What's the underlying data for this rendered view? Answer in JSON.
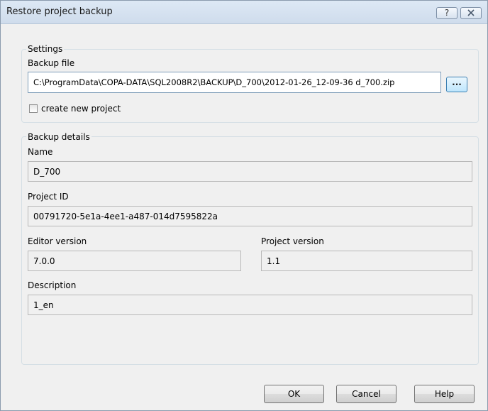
{
  "window": {
    "title": "Restore project backup",
    "help_glyph": "?",
    "close_icon": "close-icon"
  },
  "settings": {
    "group_label": "Settings",
    "backup_file_label": "Backup file",
    "backup_file_value": "C:\\ProgramData\\COPA-DATA\\SQL2008R2\\BACKUP\\D_700\\2012-01-26_12-09-36 d_700.zip",
    "browse_label": "...",
    "create_new_project_label": "create new project",
    "create_new_project_checked": false
  },
  "details": {
    "group_label": "Backup details",
    "name_label": "Name",
    "name_value": "D_700",
    "project_id_label": "Project ID",
    "project_id_value": "00791720-5e1a-4ee1-a487-014d7595822a",
    "editor_version_label": "Editor version",
    "editor_version_value": "7.0.0",
    "project_version_label": "Project version",
    "project_version_value": "1.1",
    "description_label": "Description",
    "description_value": "1_en"
  },
  "buttons": {
    "ok": "OK",
    "cancel": "Cancel",
    "help": "Help"
  }
}
